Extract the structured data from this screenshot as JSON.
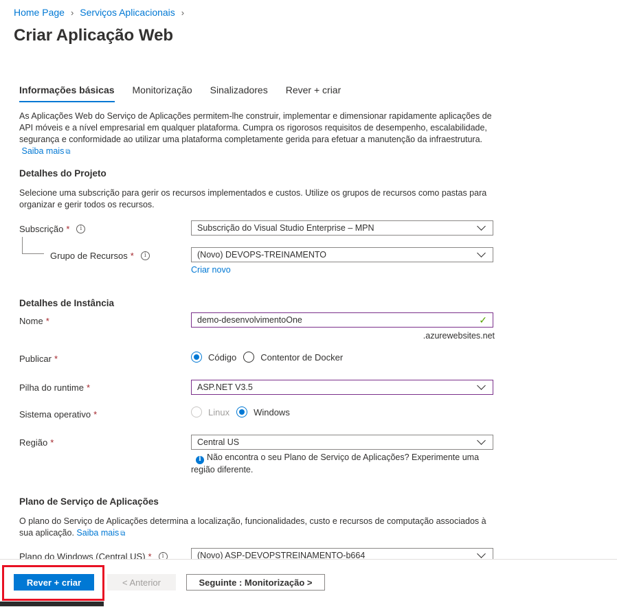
{
  "breadcrumb": [
    "Home Page",
    "Serviços Aplicacionais"
  ],
  "page_title": "Criar Aplicação Web",
  "tabs": [
    "Informações básicas",
    "Monitorização",
    "Sinalizadores",
    "Rever + criar"
  ],
  "intro": {
    "text": "As Aplicações Web do Serviço de Aplicações permitem-lhe construir, implementar e dimensionar rapidamente aplicações de API móveis e a nível empresarial em qualquer plataforma. Cumpra os rigorosos requisitos de desempenho, escalabilidade, segurança e conformidade ao utilizar uma plataforma completamente gerida para efetuar a manutenção da infraestrutura.",
    "link": "Saiba mais"
  },
  "project": {
    "heading": "Detalhes do Projeto",
    "desc": "Selecione uma subscrição para gerir os recursos implementados e custos. Utilize os grupos de recursos como pastas para organizar e gerir todos os recursos.",
    "subscription_label": "Subscrição",
    "subscription_value": "Subscrição do Visual Studio Enterprise – MPN",
    "rg_label": "Grupo de Recursos",
    "rg_value": "(Novo) DEVOPS-TREINAMENTO",
    "create_new": "Criar novo"
  },
  "instance": {
    "heading": "Detalhes de Instância",
    "name_label": "Nome",
    "name_value": "demo-desenvolvimentoOne",
    "domain_suffix": ".azurewebsites.net",
    "publish_label": "Publicar",
    "publish_options": [
      "Código",
      "Contentor de Docker"
    ],
    "publish_selected": "Código",
    "runtime_label": "Pilha do runtime",
    "runtime_value": "ASP.NET V3.5",
    "os_label": "Sistema operativo",
    "os_options": [
      "Linux",
      "Windows"
    ],
    "os_selected": "Windows",
    "region_label": "Região",
    "region_value": "Central US",
    "region_hint": "Não encontra o seu Plano de Serviço de Aplicações? Experimente uma região diferente."
  },
  "plan": {
    "heading": "Plano de Serviço de Aplicações",
    "desc": "O plano do Serviço de Aplicações determina a localização, funcionalidades, custo e recursos de computação associados à sua aplicação.",
    "link": "Saiba mais",
    "windows_plan_label": "Plano do Windows (Central US)",
    "windows_plan_value": "(Novo) ASP-DEVOPSTREINAMENTO-b664"
  },
  "footer": {
    "review_create": "Rever + criar",
    "previous": "< Anterior",
    "next": "Seguinte : Monitorização >"
  },
  "colors": {
    "accent": "#0078d4",
    "highlight": "#e81123",
    "required": "#a4262c",
    "valid": "#57a300"
  }
}
